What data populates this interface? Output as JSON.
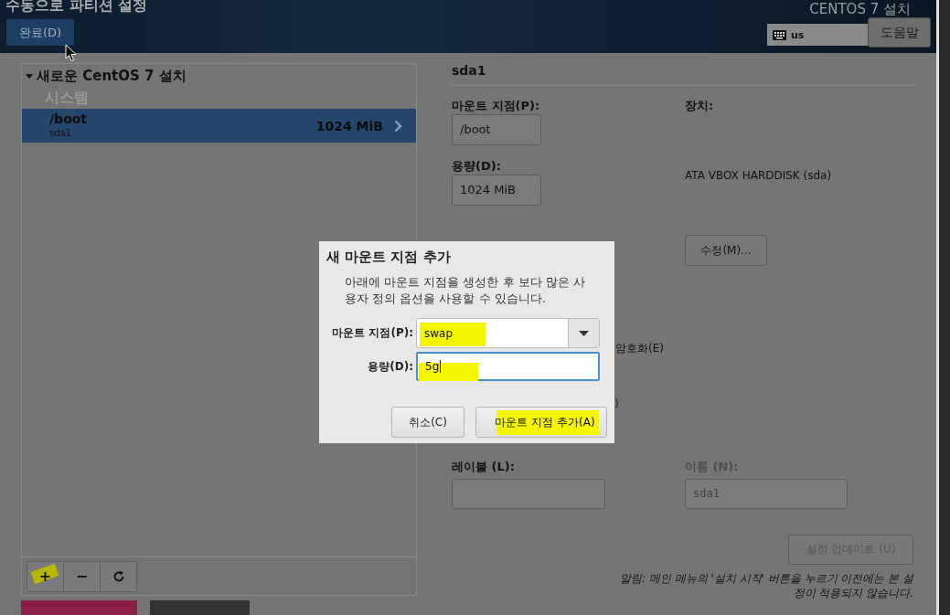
{
  "header": {
    "title": "수동으로 파티션 설정",
    "done_button": "완료(D)",
    "product": "CENTOS 7 설치",
    "keyboard": "us",
    "help_button": "도움말"
  },
  "tree": {
    "group": {
      "label": "새로운 CentOS 7 설치",
      "expanded": true
    },
    "section": "시스템",
    "items": [
      {
        "mount": "/boot",
        "device": "sda1",
        "size": "1024 MiB",
        "selected": true
      }
    ]
  },
  "toolbar": [
    {
      "kind": "add",
      "label": "+",
      "highlighted": true
    },
    {
      "kind": "remove",
      "label": "−",
      "highlighted": false
    },
    {
      "kind": "refresh",
      "highlighted": false
    }
  ],
  "details": {
    "title": "sda1",
    "mount_label": "마운트 지점(P):",
    "mount_value": "/boot",
    "size_label": "용량(D):",
    "size_value": "1024 MiB",
    "device_label": "장치:",
    "device_value": "ATA VBOX HARDDISK (sda)",
    "modify_button": "수정(M)...",
    "encrypt_fragment": "암호화(E)",
    "paren_fragment": ")",
    "label_label": "레이블 (L):",
    "name_label": "이름 (N):",
    "name_value": "sda1",
    "name_disabled": true,
    "update_button": "설정 업데이트 (U)",
    "update_disabled": true,
    "note": "알림: 메인 메뉴의 '설치 시작' 버튼을 누르기 이전에는 본 설정이 적용되지 않습니다."
  },
  "dialog": {
    "title": "새 마운트 지점 추가",
    "description": "아래에 마운트 지점을 생성한 후 보다 많은 사용자 정의 옵션을 사용할 수 있습니다.",
    "mount_label": "마운트 지점(P):",
    "mount_value": "swap",
    "mount_highlighted": true,
    "size_label": "용량(D):",
    "size_value": "5g",
    "size_highlighted": true,
    "cancel_button": "취소(C)",
    "add_button": "마운트 지점 추가(A)",
    "add_highlighted": true
  }
}
